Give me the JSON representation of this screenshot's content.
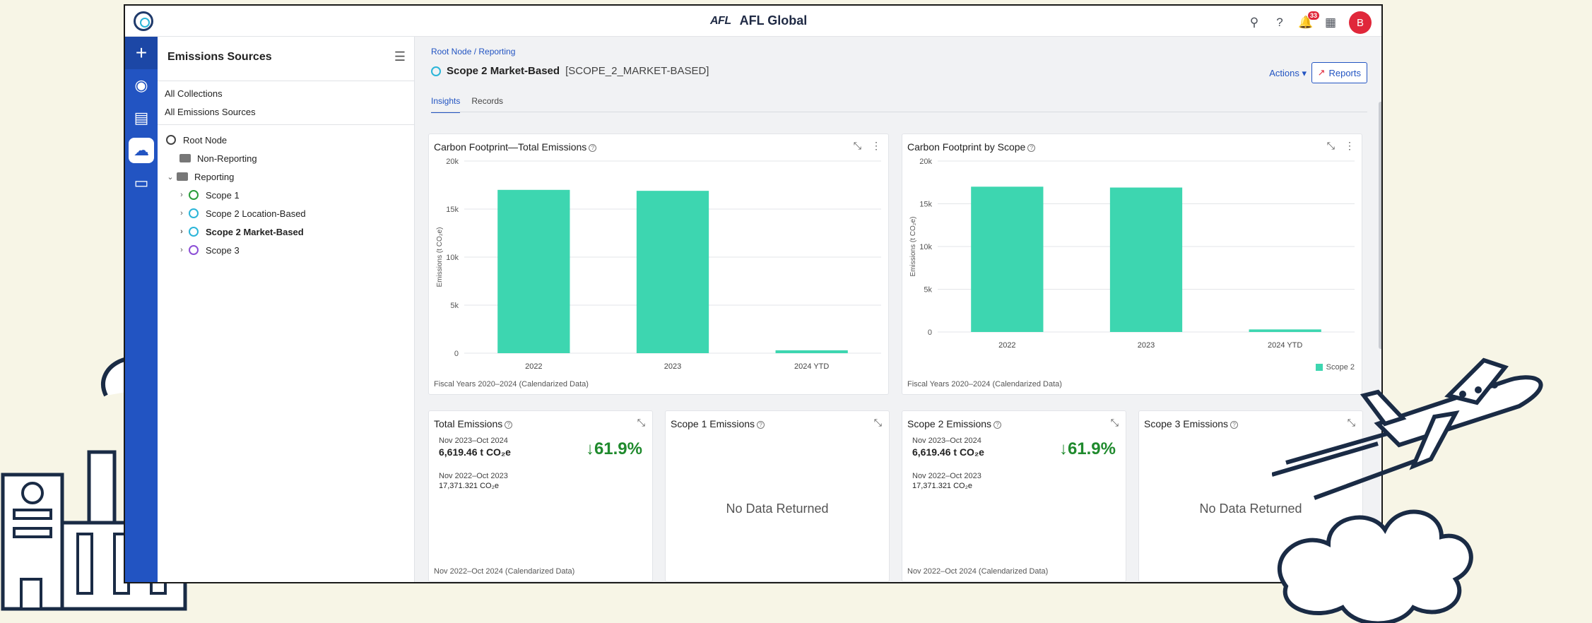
{
  "topbar": {
    "brand_logo": "AFL",
    "brand_name": "AFL Global",
    "notif_count": "33",
    "avatar_initial": "B"
  },
  "sidebar": {
    "title": "Emissions Sources",
    "links": [
      "All Collections",
      "All Emissions Sources"
    ],
    "tree": [
      {
        "label": "Root Node"
      },
      {
        "label": "Non-Reporting"
      },
      {
        "label": "Reporting"
      },
      {
        "label": "Scope 1"
      },
      {
        "label": "Scope 2 Location-Based"
      },
      {
        "label": "Scope 2 Market-Based"
      },
      {
        "label": "Scope 3"
      }
    ]
  },
  "page": {
    "breadcrumb": "Root Node / Reporting",
    "title": "Scope 2 Market-Based",
    "code": "[SCOPE_2_MARKET-BASED]",
    "actions_label": "Actions",
    "reports_label": "Reports",
    "tabs": [
      "Insights",
      "Records"
    ]
  },
  "cards": {
    "total_chart": {
      "title": "Carbon Footprint—Total Emissions",
      "footnote": "Fiscal Years 2020–2024 (Calendarized Data)"
    },
    "scope_chart": {
      "title": "Carbon Footprint by Scope",
      "footnote": "Fiscal Years 2020–2024 (Calendarized Data)",
      "legend": "Scope 2"
    },
    "total_kpi": {
      "title": "Total Emissions",
      "period1": "Nov 2023–Oct 2024",
      "value1": "6,619.46 t CO₂e",
      "pct": "↓61.9%",
      "period2": "Nov 2022–Oct 2023",
      "value2": "17,371.321 CO₂e",
      "footnote": "Nov 2022–Oct 2024 (Calendarized Data)"
    },
    "scope1_kpi": {
      "title": "Scope 1 Emissions",
      "nodata": "No Data Returned"
    },
    "scope2_kpi": {
      "title": "Scope 2 Emissions",
      "period1": "Nov 2023–Oct 2024",
      "value1": "6,619.46 t CO₂e",
      "pct": "↓61.9%",
      "period2": "Nov 2022–Oct 2023",
      "value2": "17,371.321 CO₂e",
      "footnote": "Nov 2022–Oct 2024 (Calendarized Data)"
    },
    "scope3_kpi": {
      "title": "Scope 3 Emissions",
      "nodata": "No Data Returned"
    }
  },
  "chart_data": [
    {
      "type": "bar",
      "title": "Carbon Footprint—Total Emissions",
      "categories": [
        "2022",
        "2023",
        "2024 YTD"
      ],
      "values": [
        17000,
        16900,
        300
      ],
      "ylabel": "Emissions (t CO₂e)",
      "ylim": [
        0,
        20000
      ],
      "yticks": [
        "0",
        "5k",
        "10k",
        "15k",
        "20k"
      ],
      "color": "#3dd6b0",
      "grid": true
    },
    {
      "type": "bar",
      "title": "Carbon Footprint by Scope",
      "categories": [
        "2022",
        "2023",
        "2024 YTD"
      ],
      "series": [
        {
          "name": "Scope 2",
          "values": [
            17000,
            16900,
            300
          ]
        }
      ],
      "ylabel": "Emissions (t CO₂e)",
      "ylim": [
        0,
        20000
      ],
      "yticks": [
        "0",
        "5k",
        "10k",
        "15k",
        "20k"
      ],
      "color": "#3dd6b0",
      "legend": "bottom-right",
      "grid": true
    }
  ]
}
